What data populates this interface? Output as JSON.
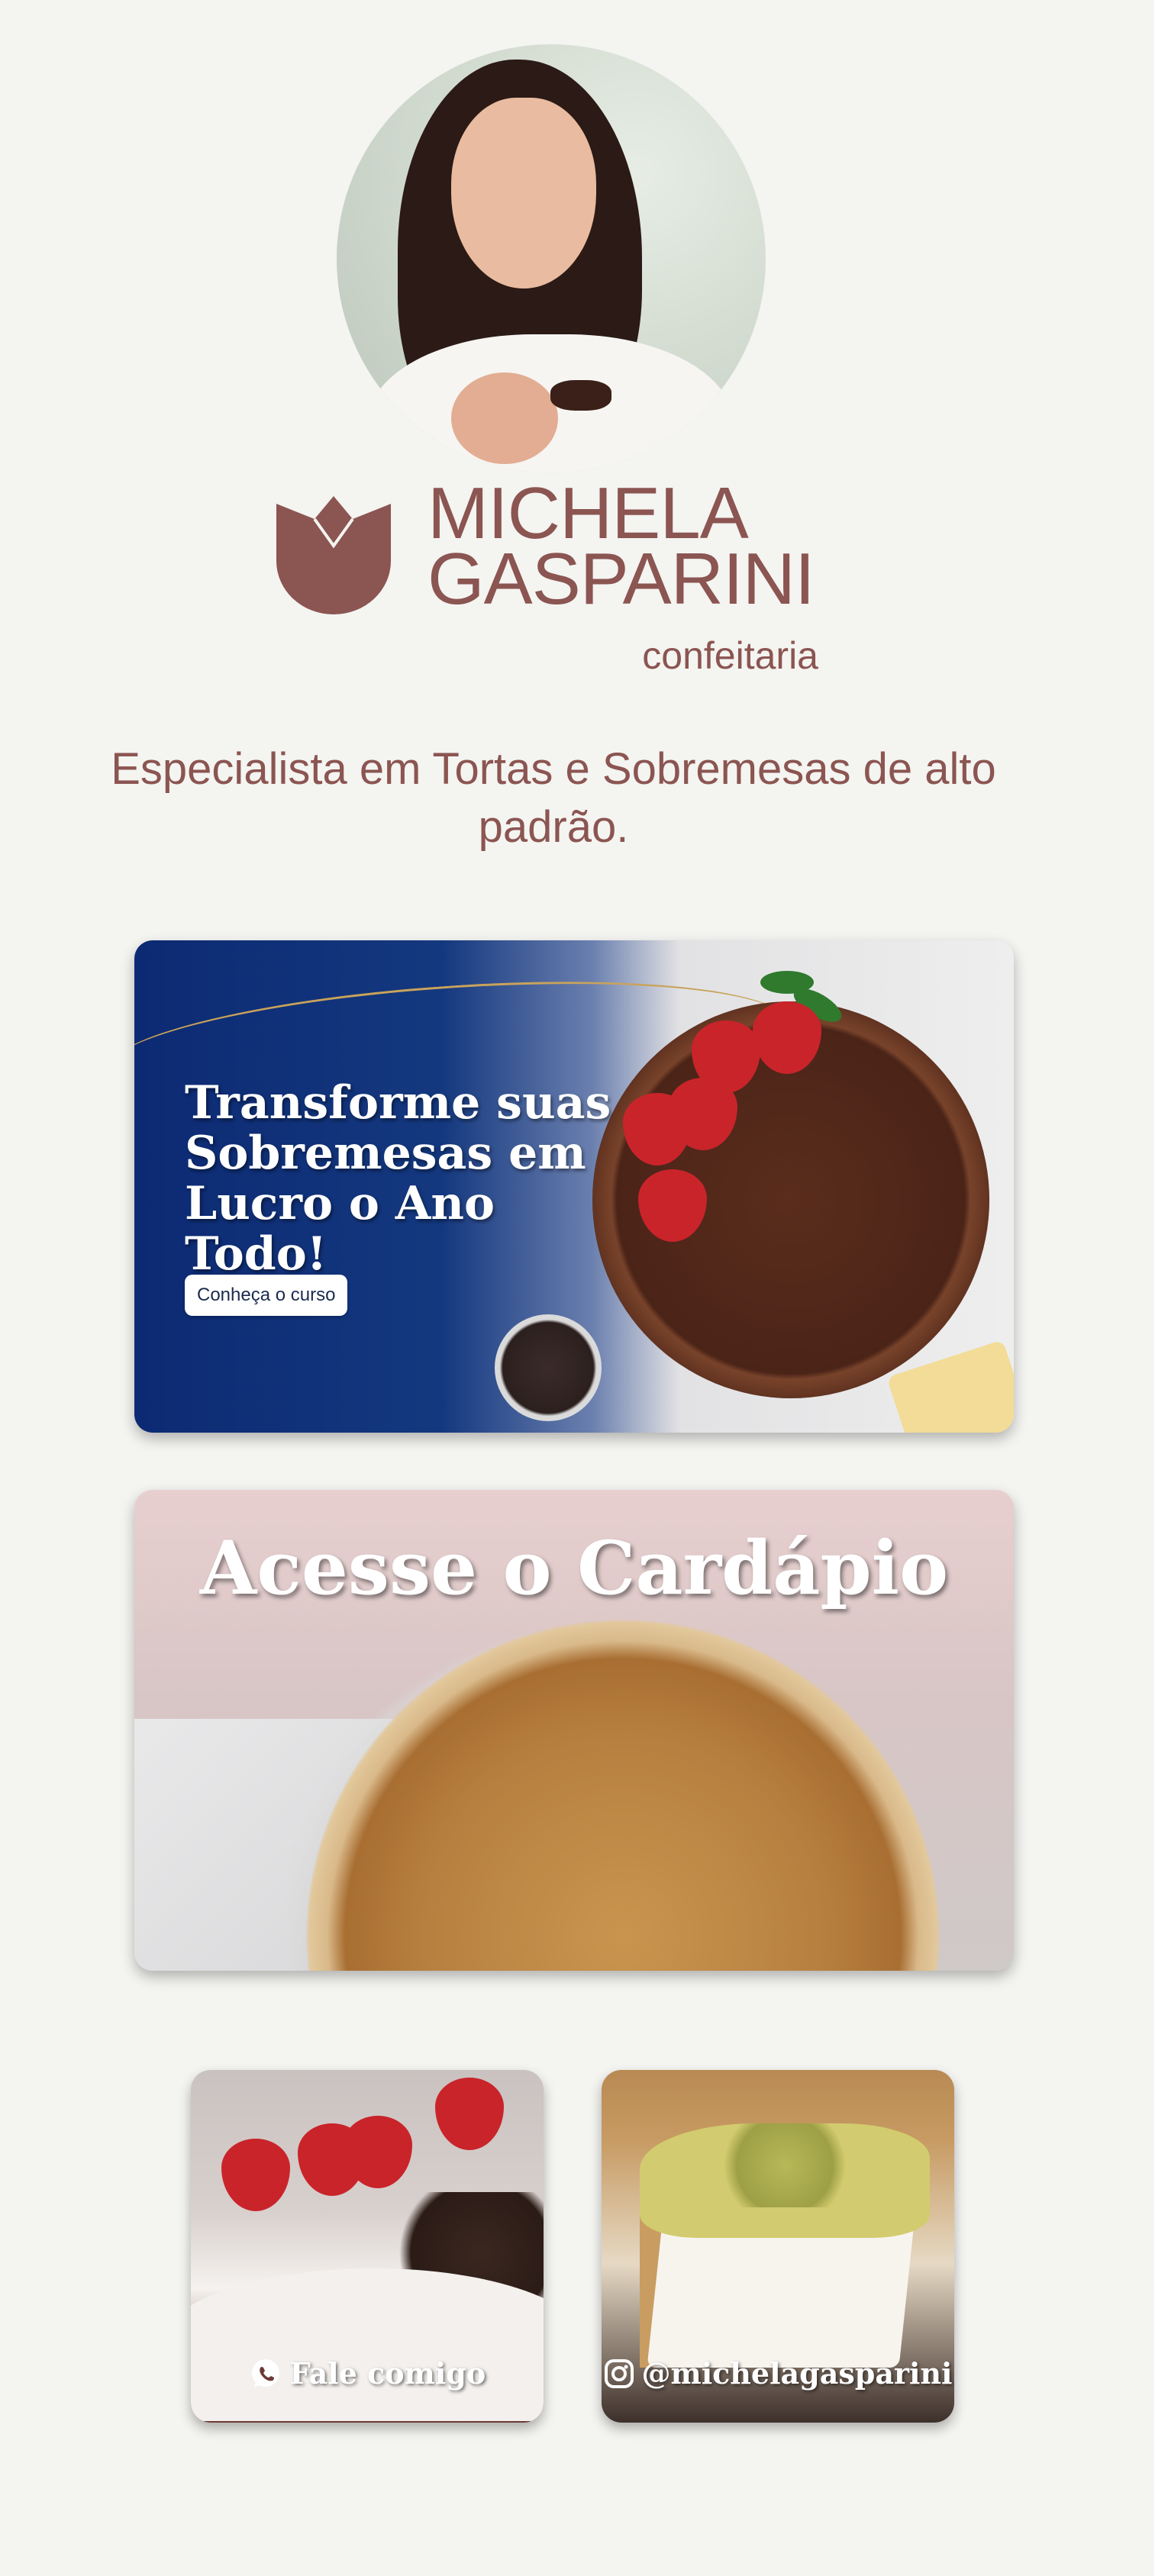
{
  "brand": {
    "name_line1": "MICHELA",
    "name_line2": "GASPARINI",
    "subtitle": "confeitaria",
    "color": "#8b5551"
  },
  "tagline": "Especialista em Tortas e Sobremesas de alto padrão.",
  "course_banner": {
    "title": "Transforme suas Sobremesas em Lucro o Ano Todo!",
    "button_label": "Conheça o curso",
    "background_color": "#0c2a73"
  },
  "menu_banner": {
    "title": "Acesse o Cardápio"
  },
  "tiles": [
    {
      "label": "Fale comigo",
      "icon": "whatsapp-icon"
    },
    {
      "label": "@michelagasparini",
      "icon": "instagram-icon"
    }
  ]
}
